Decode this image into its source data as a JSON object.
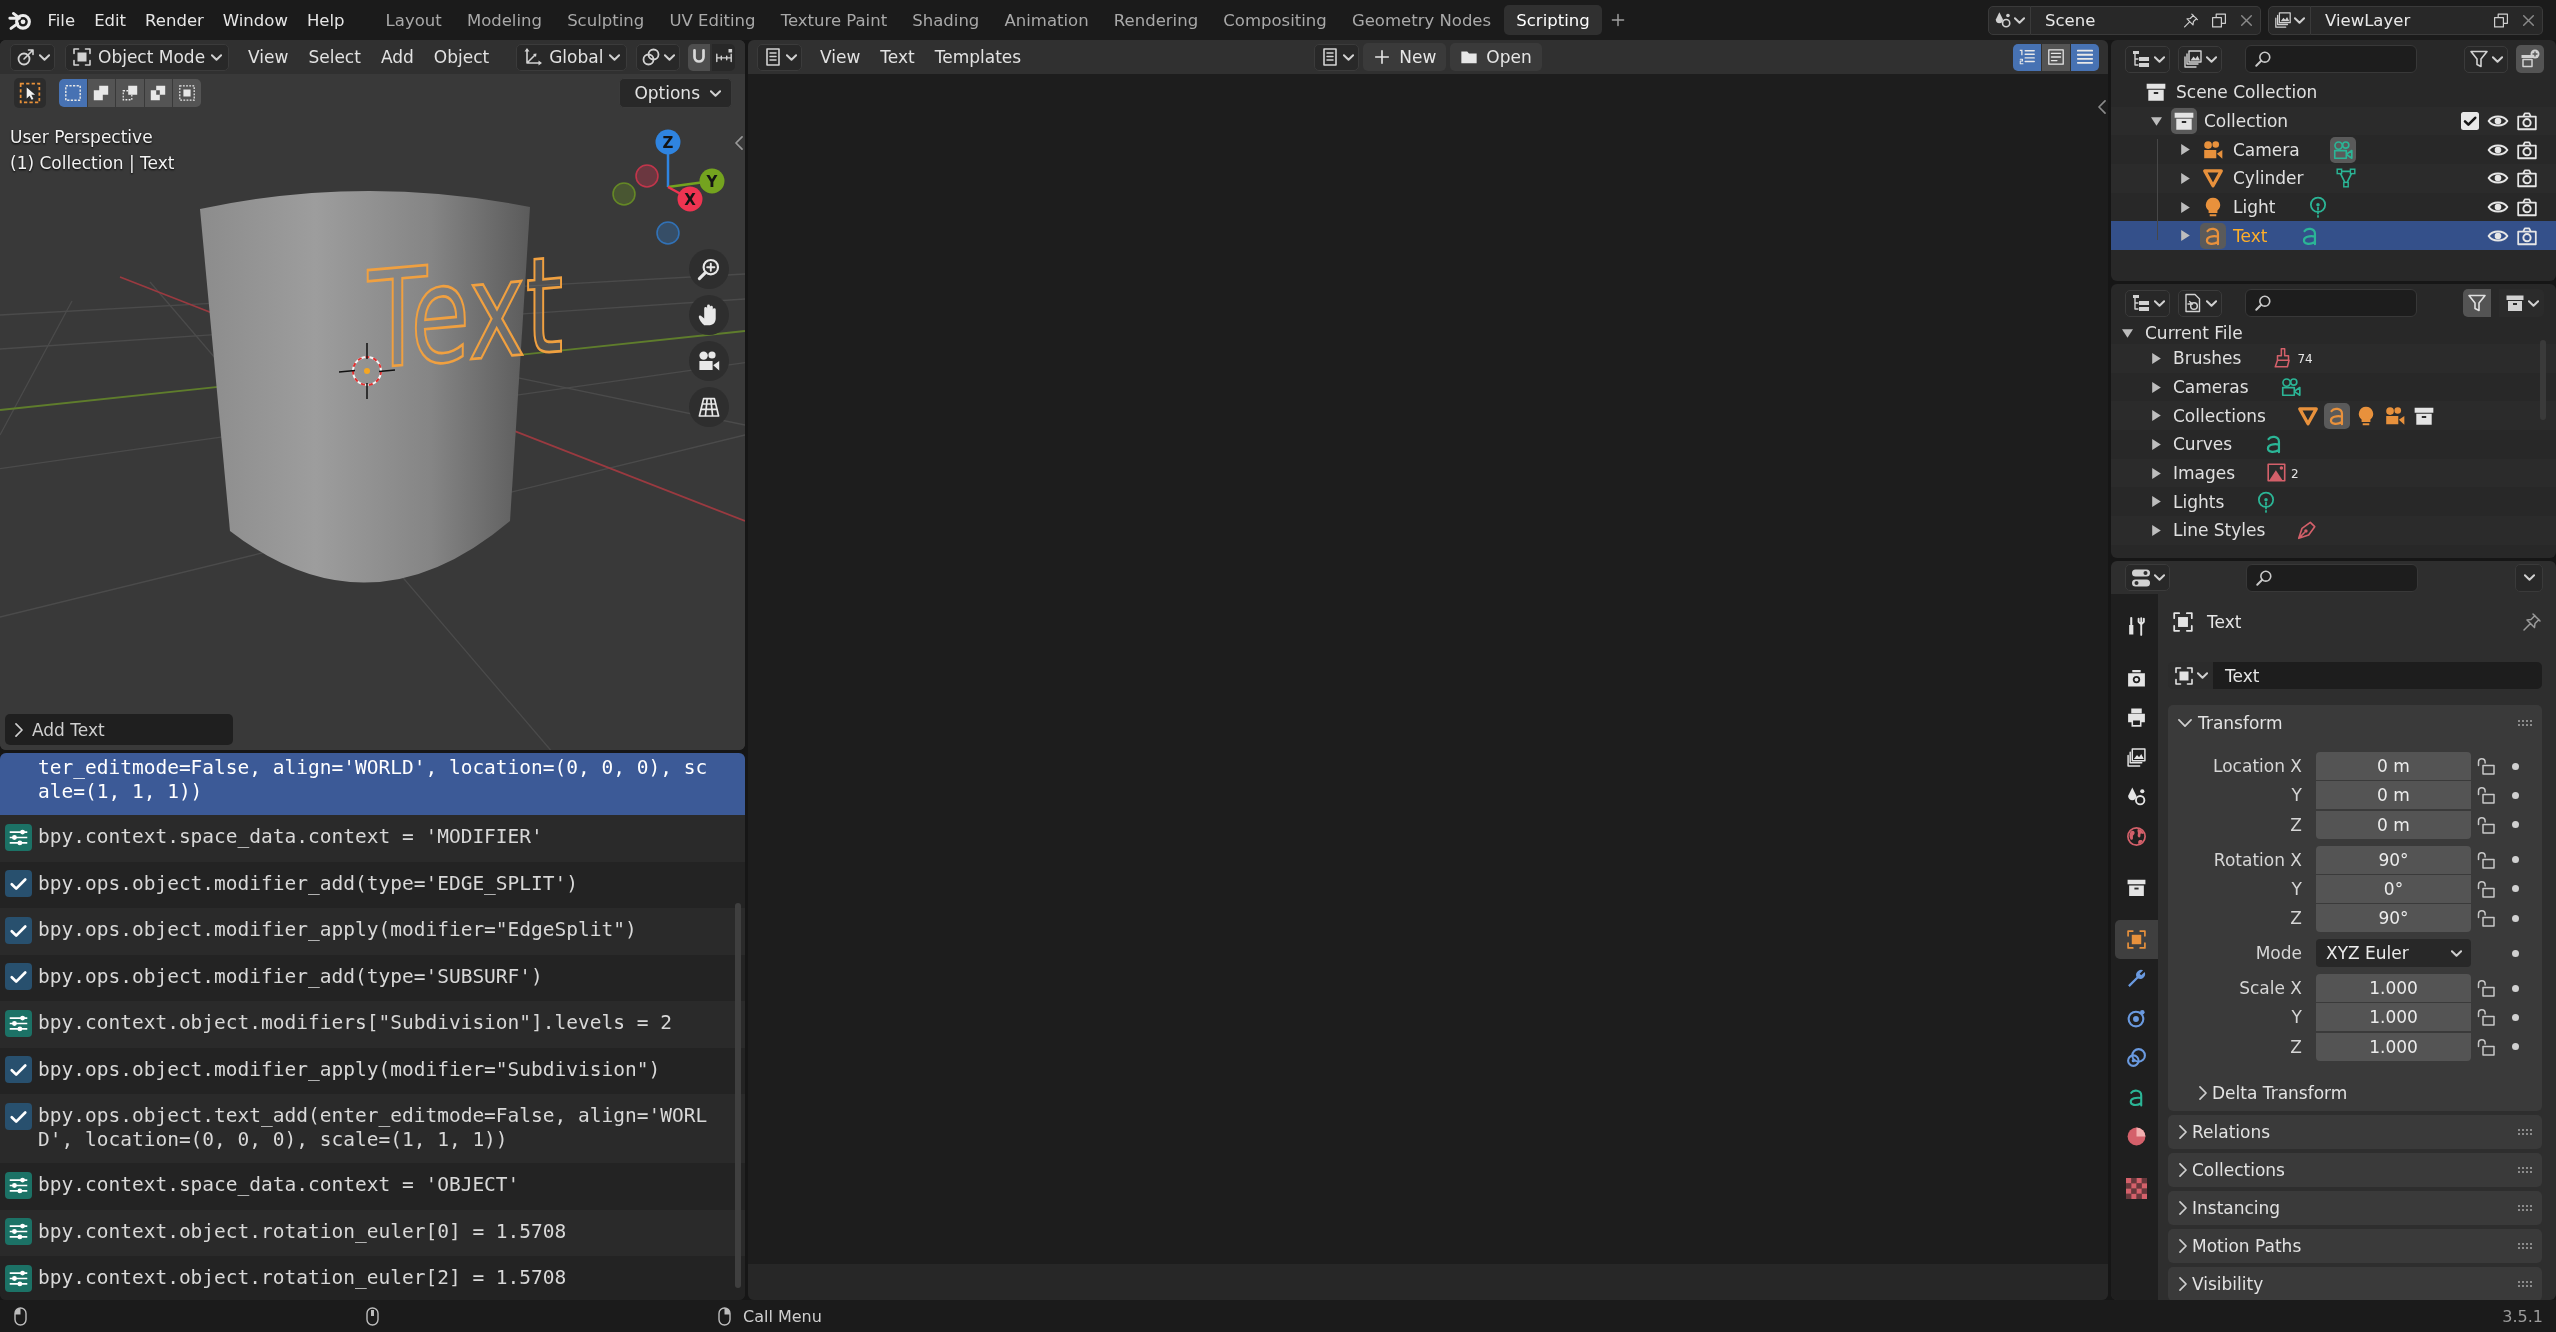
{
  "topbar": {
    "menus": [
      "File",
      "Edit",
      "Render",
      "Window",
      "Help"
    ],
    "workspaces": [
      {
        "label": "Layout",
        "selected": false
      },
      {
        "label": "Modeling",
        "selected": false
      },
      {
        "label": "Sculpting",
        "selected": false
      },
      {
        "label": "UV Editing",
        "selected": false
      },
      {
        "label": "Texture Paint",
        "selected": false
      },
      {
        "label": "Shading",
        "selected": false
      },
      {
        "label": "Animation",
        "selected": false
      },
      {
        "label": "Rendering",
        "selected": false
      },
      {
        "label": "Compositing",
        "selected": false
      },
      {
        "label": "Geometry Nodes",
        "selected": false
      },
      {
        "label": "Scripting",
        "selected": true
      }
    ],
    "scene": "Scene",
    "view_layer": "ViewLayer"
  },
  "viewport": {
    "mode": "Object Mode",
    "menus": [
      "View",
      "Select",
      "Add",
      "Object"
    ],
    "orientation": "Global",
    "select_modes": [
      {
        "kind": "set",
        "selected": true
      },
      {
        "kind": "extend",
        "selected": false
      },
      {
        "kind": "subtract",
        "selected": false
      },
      {
        "kind": "difference",
        "selected": false
      },
      {
        "kind": "intersect",
        "selected": false
      }
    ],
    "options": "Options",
    "overlay": [
      "User Perspective",
      "(1) Collection | Text"
    ],
    "text_object": "Text",
    "gizmo": [
      {
        "label": "Z",
        "color": "#2f84e0"
      },
      {
        "label": "Y",
        "color": "#74a31f"
      },
      {
        "label": "X",
        "color": "#ee3451"
      }
    ],
    "last_operator": {
      "label": "Add Text",
      "expanded": false
    }
  },
  "info_log": [
    {
      "kind": "continued",
      "text": "ter_editmode=False, align='WORLD', location=(0, 0, 0), scale=(1, 1, 1))",
      "selected": true
    },
    {
      "kind": "property",
      "text": "bpy.context.space_data.context = 'MODIFIER'",
      "selected": false
    },
    {
      "kind": "operator",
      "text": "bpy.ops.object.modifier_add(type='EDGE_SPLIT')",
      "selected": false
    },
    {
      "kind": "operator",
      "text": "bpy.ops.object.modifier_apply(modifier=\"EdgeSplit\")",
      "selected": false
    },
    {
      "kind": "operator",
      "text": "bpy.ops.object.modifier_add(type='SUBSURF')",
      "selected": false
    },
    {
      "kind": "property",
      "text": "bpy.context.object.modifiers[\"Subdivision\"].levels = 2",
      "selected": false
    },
    {
      "kind": "operator",
      "text": "bpy.ops.object.modifier_apply(modifier=\"Subdivision\")",
      "selected": false
    },
    {
      "kind": "operator",
      "text": "bpy.ops.object.text_add(enter_editmode=False, align='WORLD', location=(0, 0, 0), scale=(1, 1, 1))",
      "selected": false
    },
    {
      "kind": "property",
      "text": "bpy.context.space_data.context = 'OBJECT'",
      "selected": false
    },
    {
      "kind": "property",
      "text": "bpy.context.object.rotation_euler[0] = 1.5708",
      "selected": false
    },
    {
      "kind": "property",
      "text": "bpy.context.object.rotation_euler[2] = 1.5708",
      "selected": false
    }
  ],
  "text_editor": {
    "menus": [
      "View",
      "Text",
      "Templates"
    ],
    "buttons": [
      {
        "kind": "new",
        "label": "New"
      },
      {
        "kind": "open",
        "label": "Open"
      }
    ],
    "toggles": [
      {
        "kind": "line_numbers",
        "on": true
      },
      {
        "kind": "word_wrap",
        "on": false
      },
      {
        "kind": "syntax",
        "on": true
      }
    ]
  },
  "outliner": {
    "root": {
      "label": "Scene Collection",
      "children": [
        {
          "label": "Collection",
          "expanded": true,
          "active": true,
          "checked": true,
          "visible": true,
          "children": [
            {
              "label": "Camera",
              "kind": "camera",
              "expanded": false,
              "selected": false,
              "data_active": true,
              "visible": true
            },
            {
              "label": "Cylinder",
              "kind": "mesh",
              "expanded": false,
              "selected": false,
              "data_active": false,
              "visible": true
            },
            {
              "label": "Light",
              "kind": "light",
              "expanded": false,
              "selected": false,
              "data_active": false,
              "visible": true
            },
            {
              "label": "Text",
              "kind": "text",
              "expanded": false,
              "selected": true,
              "data_active": false,
              "visible": true
            }
          ]
        }
      ]
    }
  },
  "blend_file": {
    "filter_on": true,
    "tree": {
      "label": "Current File",
      "expanded": true,
      "children": [
        {
          "label": "Brushes",
          "expanded": false,
          "icons": [
            {
              "kind": "brush",
              "count": "74",
              "active": false
            }
          ]
        },
        {
          "label": "Cameras",
          "expanded": false,
          "icons": [
            {
              "kind": "camera_data",
              "active": false
            }
          ]
        },
        {
          "label": "Collections",
          "expanded": false,
          "icons": [
            {
              "kind": "mesh_object",
              "active": false
            },
            {
              "kind": "text_object",
              "active": true
            },
            {
              "kind": "light_object",
              "active": false
            },
            {
              "kind": "camera_object",
              "active": false
            },
            {
              "kind": "collection",
              "active": false
            }
          ]
        },
        {
          "label": "Curves",
          "expanded": false,
          "icons": [
            {
              "kind": "curve_data",
              "active": false
            }
          ]
        },
        {
          "label": "Images",
          "expanded": false,
          "icons": [
            {
              "kind": "image",
              "count": "2",
              "active": false
            }
          ]
        },
        {
          "label": "Lights",
          "expanded": false,
          "icons": [
            {
              "kind": "light_data",
              "active": false
            }
          ]
        },
        {
          "label": "Line Styles",
          "expanded": false,
          "icons": [
            {
              "kind": "line_style",
              "active": false
            }
          ]
        }
      ]
    }
  },
  "properties": {
    "tabs": [
      [
        {
          "kind": "tool",
          "selected": false
        }
      ],
      [
        {
          "kind": "render",
          "selected": false
        },
        {
          "kind": "output",
          "selected": false
        },
        {
          "kind": "view_layer",
          "selected": false
        },
        {
          "kind": "scene",
          "selected": false
        },
        {
          "kind": "world",
          "selected": false
        }
      ],
      [
        {
          "kind": "collection",
          "selected": false
        }
      ],
      [
        {
          "kind": "object",
          "selected": true
        },
        {
          "kind": "modifiers",
          "selected": false
        },
        {
          "kind": "physics",
          "selected": false
        },
        {
          "kind": "constraints",
          "selected": false
        },
        {
          "kind": "data",
          "selected": false
        },
        {
          "kind": "material",
          "selected": false
        }
      ],
      [
        {
          "kind": "texture",
          "selected": false
        }
      ]
    ],
    "context": "Text",
    "datablock": "Text",
    "transform": {
      "title": "Transform",
      "expanded": true,
      "groups": [
        [
          {
            "label": "Location X",
            "value": "0 m",
            "kind": "number",
            "locked": false
          },
          {
            "label": "Y",
            "value": "0 m",
            "kind": "number",
            "locked": false
          },
          {
            "label": "Z",
            "value": "0 m",
            "kind": "number",
            "locked": false
          }
        ],
        [
          {
            "label": "Rotation X",
            "value": "90°",
            "kind": "number",
            "locked": false
          },
          {
            "label": "Y",
            "value": "0°",
            "kind": "number",
            "locked": false
          },
          {
            "label": "Z",
            "value": "90°",
            "kind": "number",
            "locked": false
          }
        ],
        [
          {
            "label": "Mode",
            "value": "XYZ Euler",
            "kind": "dropdown"
          }
        ],
        [
          {
            "label": "Scale X",
            "value": "1.000",
            "kind": "number",
            "locked": false
          },
          {
            "label": "Y",
            "value": "1.000",
            "kind": "number",
            "locked": false
          },
          {
            "label": "Z",
            "value": "1.000",
            "kind": "number",
            "locked": false
          }
        ]
      ],
      "subpanel": {
        "title": "Delta Transform",
        "expanded": false
      }
    },
    "panels": [
      {
        "title": "Relations",
        "expanded": false
      },
      {
        "title": "Collections",
        "expanded": false
      },
      {
        "title": "Instancing",
        "expanded": false
      },
      {
        "title": "Motion Paths",
        "expanded": false
      },
      {
        "title": "Visibility",
        "expanded": false
      }
    ]
  },
  "status_bar": {
    "items": [
      {
        "kind": "left_click"
      },
      {
        "kind": "middle_click"
      },
      {
        "kind": "right_click",
        "label": "Call Menu"
      }
    ],
    "version": "3.5.1"
  }
}
